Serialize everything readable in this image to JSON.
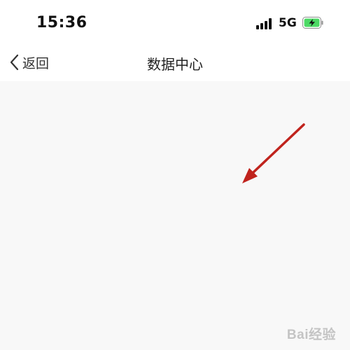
{
  "status_bar": {
    "time": "15:36",
    "network": "5G",
    "signal_icon": "signal-bars-icon",
    "battery_icon": "battery-charging-icon",
    "battery_color": "#4cd964"
  },
  "nav": {
    "back_label": "返回",
    "back_icon": "chevron-left-icon",
    "title": "数据中心"
  },
  "content": {
    "background": "#f8f8f8",
    "annotation_arrow_color": "#c0231d"
  },
  "watermark": {
    "text": "Bai经验",
    "logo_icon": "paw-icon"
  }
}
